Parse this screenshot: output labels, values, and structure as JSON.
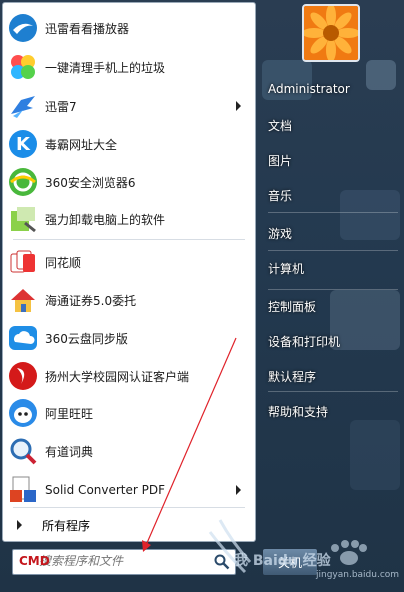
{
  "menu": {
    "items": [
      {
        "label": "迅雷看看播放器",
        "icon": "xunlei-kankan-icon",
        "submenu": false
      },
      {
        "label": "一键清理手机上的垃圾",
        "icon": "phone-cleaner-icon",
        "submenu": false
      },
      {
        "label": "迅雷7",
        "icon": "xunlei-bird-icon",
        "submenu": true
      },
      {
        "label": "毒霸网址大全",
        "icon": "duba-k-icon",
        "submenu": false
      },
      {
        "label": "360安全浏览器6",
        "icon": "360-browser-icon",
        "submenu": false
      },
      {
        "label": "强力卸载电脑上的软件",
        "icon": "uninstaller-icon",
        "submenu": false
      },
      {
        "label": "同花顺",
        "icon": "tonghuashun-cards-icon",
        "submenu": false
      },
      {
        "label": "海通证券5.0委托",
        "icon": "haitong-house-icon",
        "submenu": false
      },
      {
        "label": "360云盘同步版",
        "icon": "360-cloud-icon",
        "submenu": false
      },
      {
        "label": "扬州大学校园网认证客户端",
        "icon": "yzu-client-icon",
        "submenu": false
      },
      {
        "label": "阿里旺旺",
        "icon": "aliwangwang-icon",
        "submenu": false
      },
      {
        "label": "有道词典",
        "icon": "youdao-dict-icon",
        "submenu": false
      },
      {
        "label": "Solid Converter PDF",
        "icon": "pdf-converter-icon",
        "submenu": true
      }
    ],
    "all_programs": "所有程序",
    "search": {
      "typed": "CMD",
      "placeholder": "搜索程序和文件"
    }
  },
  "right": {
    "user": "Administrator",
    "items": [
      "文档",
      "图片",
      "音乐",
      "游戏",
      "计算机",
      "控制面板",
      "设备和打印机",
      "默认程序",
      "帮助和支持"
    ],
    "shutdown": "关机"
  },
  "watermark": {
    "text": "我  Baidu 经验",
    "url": "jingyan.baidu.com"
  },
  "colors": {
    "annotation_arrow": "#e0222a",
    "menu_bg": "#ffffff",
    "right_bg": "#243a50"
  }
}
